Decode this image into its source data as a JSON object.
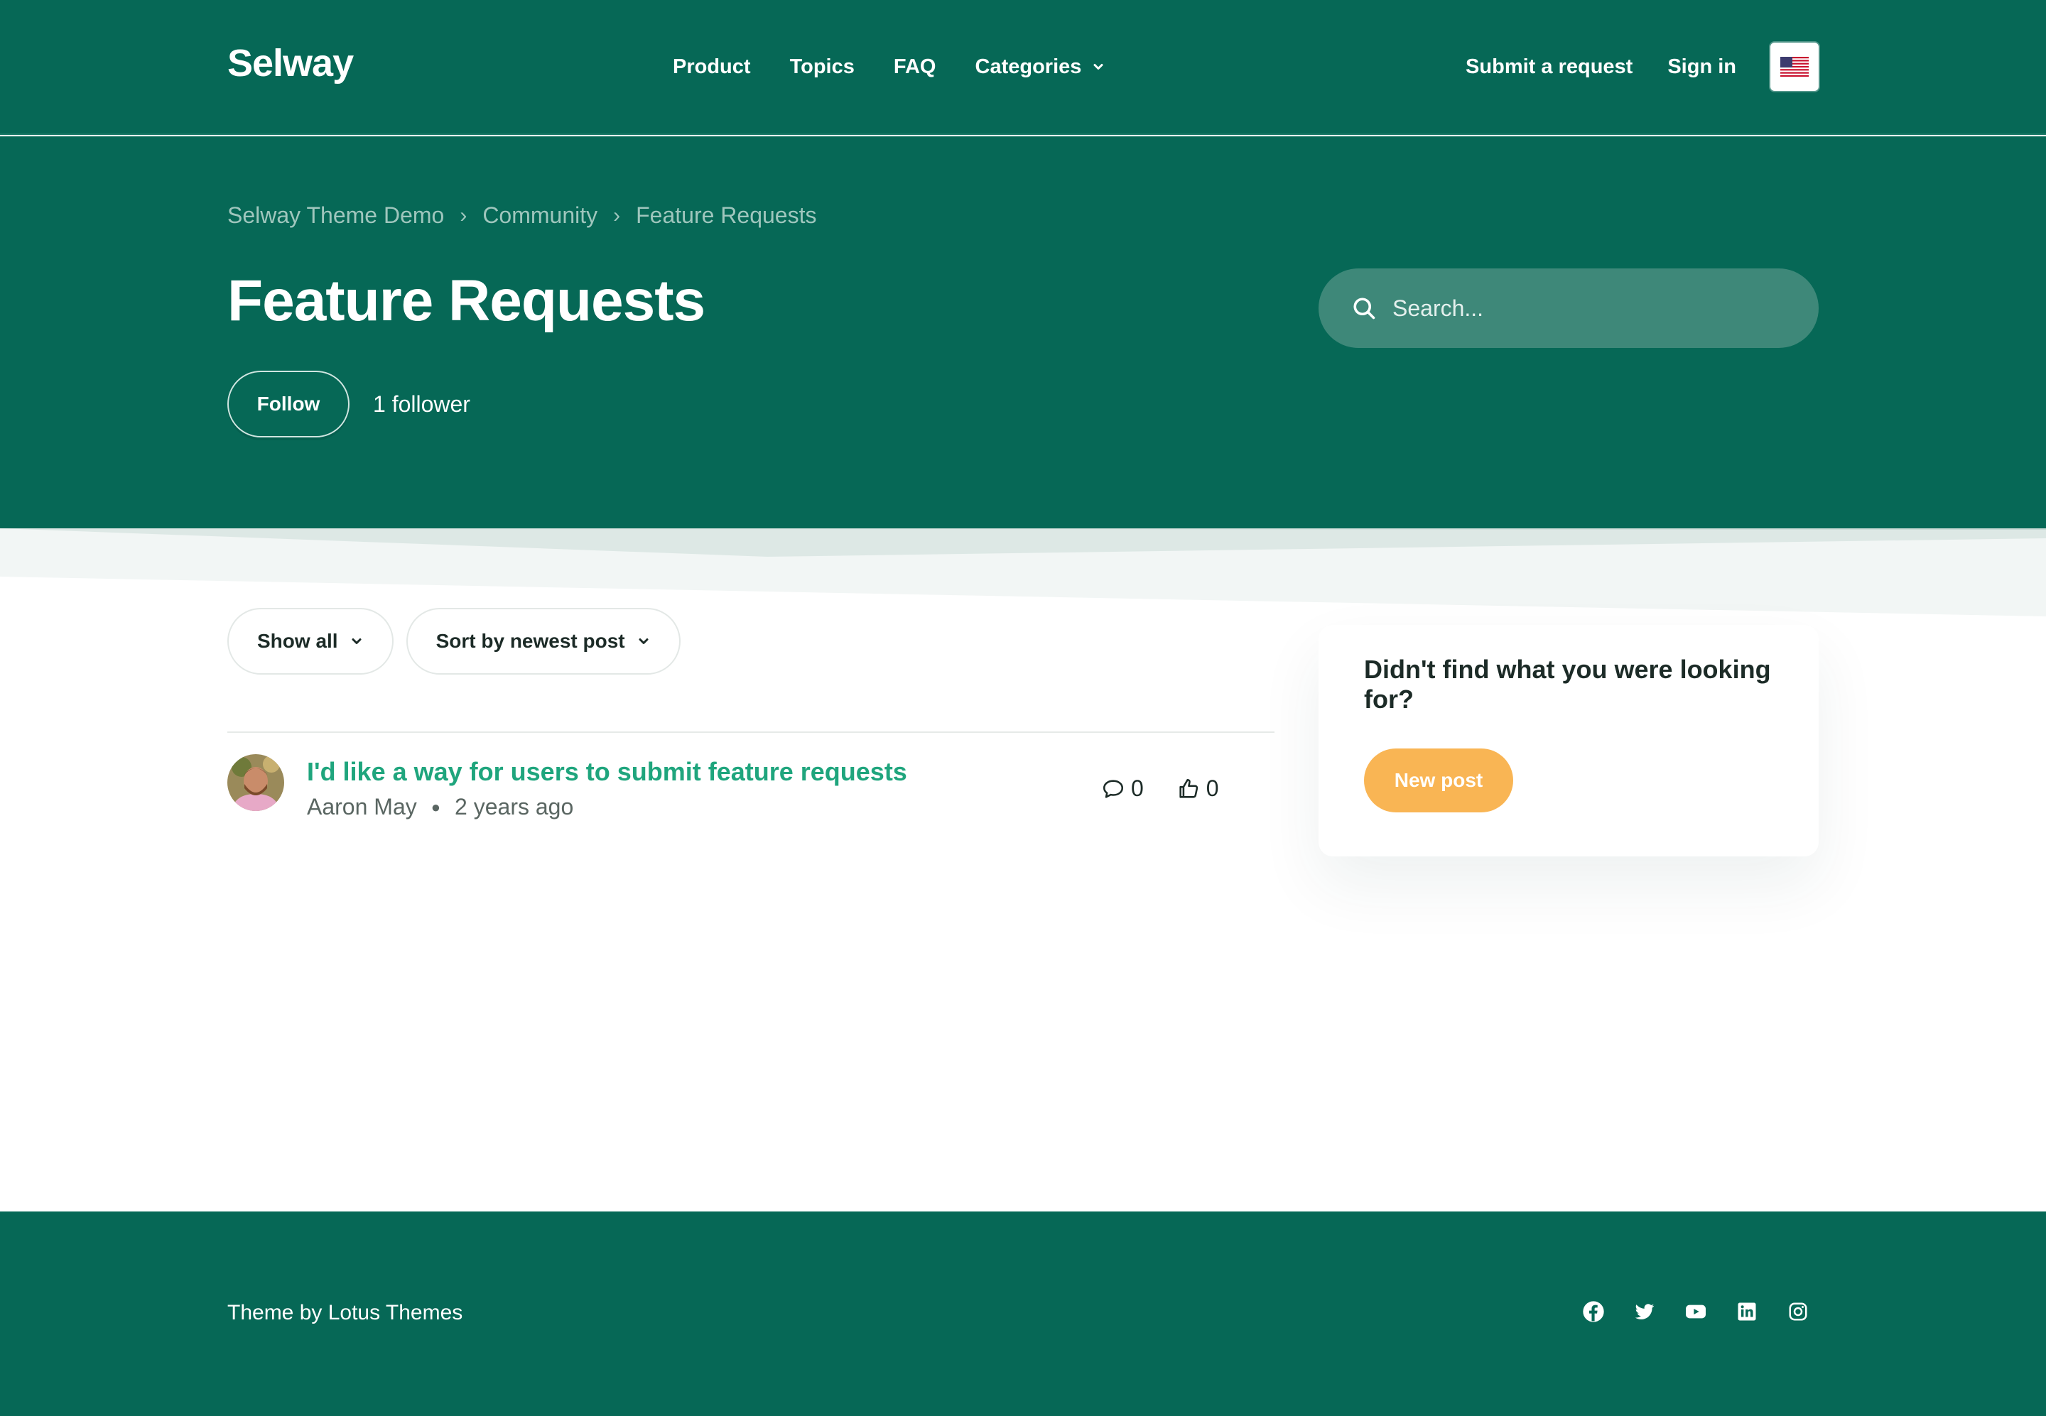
{
  "header": {
    "logo": "Selway",
    "nav": [
      {
        "label": "Product"
      },
      {
        "label": "Topics"
      },
      {
        "label": "FAQ"
      },
      {
        "label": "Categories"
      }
    ],
    "submit_request": "Submit a request",
    "sign_in": "Sign in",
    "language_icon": "us-flag-icon"
  },
  "hero": {
    "breadcrumb": [
      "Selway Theme Demo",
      "Community",
      "Feature Requests"
    ],
    "breadcrumb_separator": "›",
    "title": "Feature Requests",
    "follow_label": "Follow",
    "follower_count": "1 follower",
    "search_placeholder": "Search..."
  },
  "filters": {
    "show_all": "Show all",
    "sort": "Sort by newest post"
  },
  "posts": [
    {
      "title": "I'd like a way for users to submit feature requests",
      "author": "Aaron May",
      "time": "2 years ago",
      "comments": "0",
      "votes": "0"
    }
  ],
  "sidebar": {
    "heading": "Didn't find what you were looking for?",
    "new_post": "New post"
  },
  "footer": {
    "text": "Theme by Lotus Themes",
    "socials": [
      "facebook-icon",
      "twitter-icon",
      "youtube-icon",
      "linkedin-icon",
      "instagram-icon"
    ]
  },
  "colors": {
    "brand": "#066856",
    "link": "#1fa57d",
    "accent": "#f9b554"
  }
}
